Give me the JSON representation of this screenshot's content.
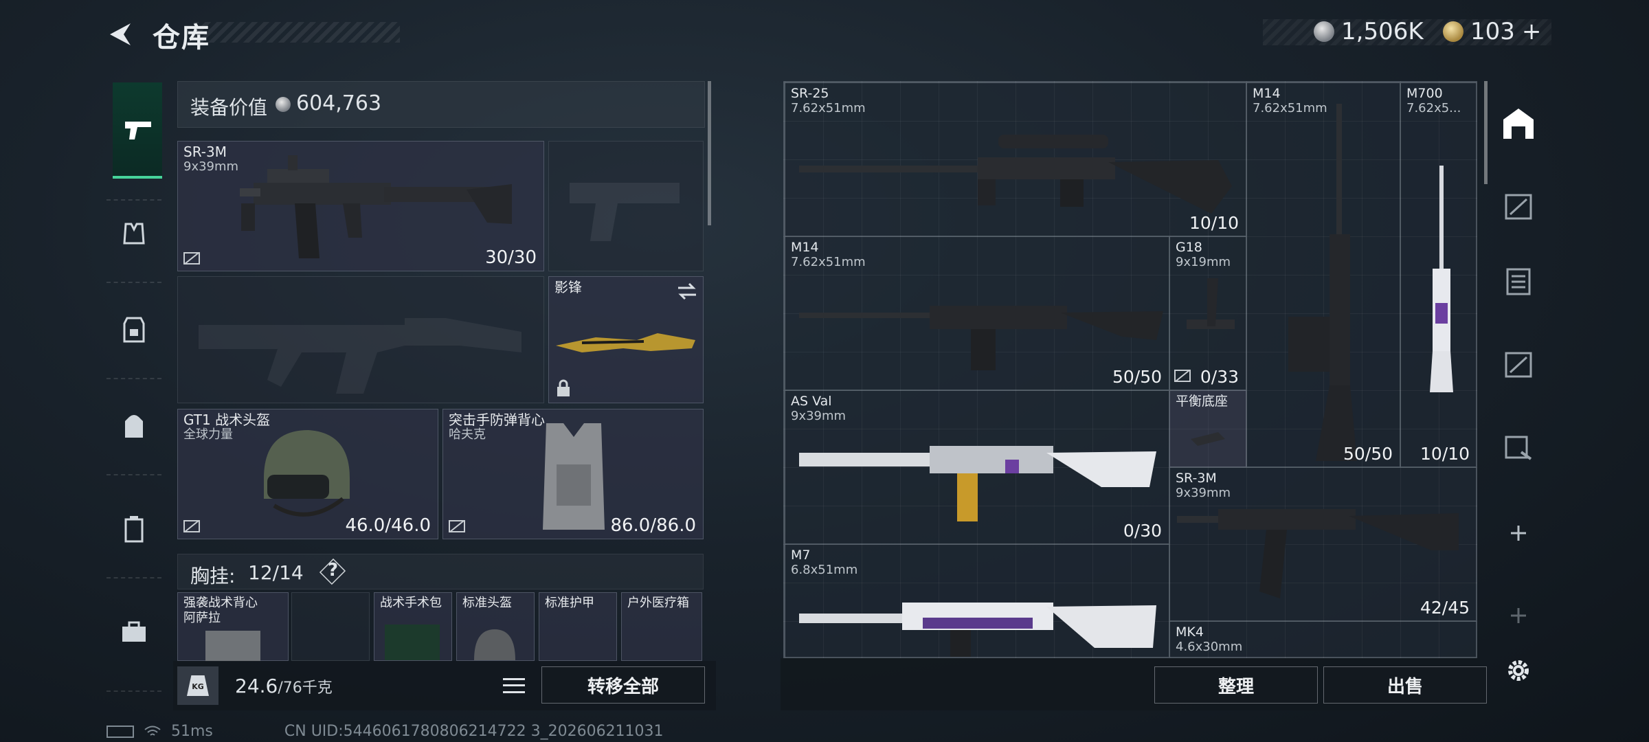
{
  "header": {
    "title": "仓库",
    "silver": "1,506K",
    "gold": "103",
    "gold_add": "+"
  },
  "loadout": {
    "equip_value_label": "装备价值",
    "equip_value": "604,763",
    "primary": {
      "name": "SR-3M",
      "caliber": "9x39mm",
      "ammo": "30/30"
    },
    "melee": {
      "name": "影锋"
    },
    "helmet": {
      "name": "GT1 战术头盔",
      "brand": "全球力量",
      "durability": "46.0/46.0"
    },
    "armor": {
      "name": "突击手防弹背心",
      "brand": "哈夫克",
      "durability": "86.0/86.0"
    },
    "rig": {
      "label": "胸挂:",
      "capacity": "12/14",
      "help": "?"
    },
    "rig_items": [
      {
        "label": "强袭战术背心"
      },
      {
        "label": "阿萨拉"
      },
      {
        "label": "战术手术包"
      },
      {
        "label": "标准头盔"
      },
      {
        "label": "标准护甲"
      },
      {
        "label": "户外医疗箱"
      }
    ],
    "weight": "24.6",
    "weight_max": "/76千克",
    "weight_icon_text": "KG",
    "transfer_all": "转移全部"
  },
  "stash": {
    "items": [
      {
        "name": "SR-25",
        "caliber": "7.62x51mm",
        "count": "10/10"
      },
      {
        "name": "M14",
        "caliber": "7.62x51mm",
        "count": "50/50"
      },
      {
        "name": "M700",
        "caliber": "7.62x5..."
      },
      {
        "name": "M14",
        "caliber": "7.62x51mm",
        "count": "50/50"
      },
      {
        "name": "G18",
        "caliber": "9x19mm",
        "count": "0/33"
      },
      {
        "name": "AS Val",
        "caliber": "9x39mm",
        "count": "0/30"
      },
      {
        "name": "平衡底座"
      },
      {
        "name": "SR-3M",
        "caliber": "9x39mm",
        "count": "42/45"
      },
      {
        "name": "M7",
        "caliber": "6.8x51mm"
      },
      {
        "name": "MK4",
        "caliber": "4.6x30mm"
      }
    ],
    "m700_count": "10/10",
    "sort": "整理",
    "sell": "出售"
  },
  "status": {
    "ping": "51ms",
    "uid": "CN UID:5446061780806214722 3_202606211031"
  }
}
